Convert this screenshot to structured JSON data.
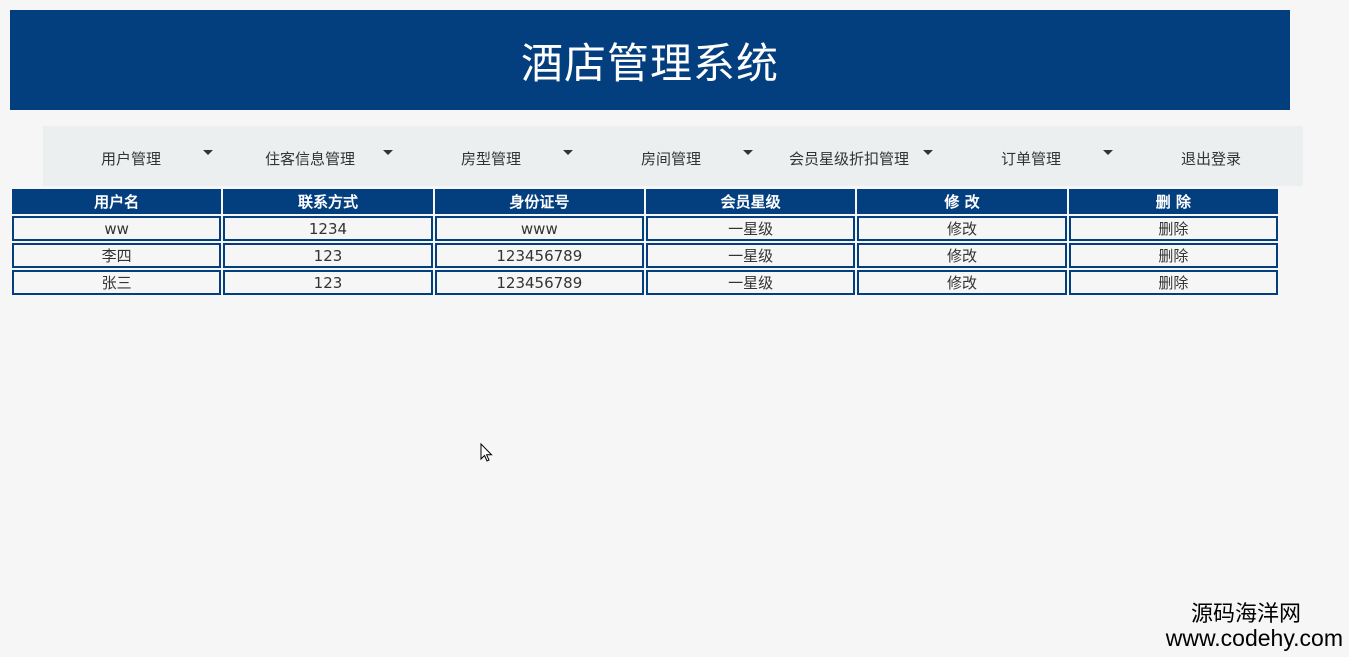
{
  "header": {
    "title": "酒店管理系统"
  },
  "nav": {
    "items": [
      {
        "label": "用户管理",
        "has_dropdown": true,
        "icon": "caret-down-icon"
      },
      {
        "label": "住客信息管理",
        "has_dropdown": true,
        "icon": "caret-down-icon"
      },
      {
        "label": "房型管理",
        "has_dropdown": true,
        "icon": "caret-down-icon"
      },
      {
        "label": "房间管理",
        "has_dropdown": true,
        "icon": "caret-down-icon"
      },
      {
        "label": "会员星级折扣管理",
        "has_dropdown": true,
        "icon": "caret-down-icon"
      },
      {
        "label": "订单管理",
        "has_dropdown": true,
        "icon": "caret-down-icon"
      },
      {
        "label": "退出登录",
        "has_dropdown": false
      }
    ]
  },
  "table": {
    "columns": [
      "用户名",
      "联系方式",
      "身份证号",
      "会员星级",
      "修 改",
      "删 除"
    ],
    "rows": [
      {
        "username": "ww",
        "contact": "1234",
        "id_number": "www",
        "level": "一星级",
        "edit": "修改",
        "delete": "删除"
      },
      {
        "username": "李四",
        "contact": "123",
        "id_number": "123456789",
        "level": "一星级",
        "edit": "修改",
        "delete": "删除"
      },
      {
        "username": "张三",
        "contact": "123",
        "id_number": "123456789",
        "level": "一星级",
        "edit": "修改",
        "delete": "删除"
      }
    ]
  },
  "watermark": {
    "title": "源码海洋网",
    "url": "www.codehy.com"
  },
  "colors": {
    "primary": "#033e7e",
    "nav_bg": "#eceff0",
    "page_bg": "#f6f6f6"
  }
}
